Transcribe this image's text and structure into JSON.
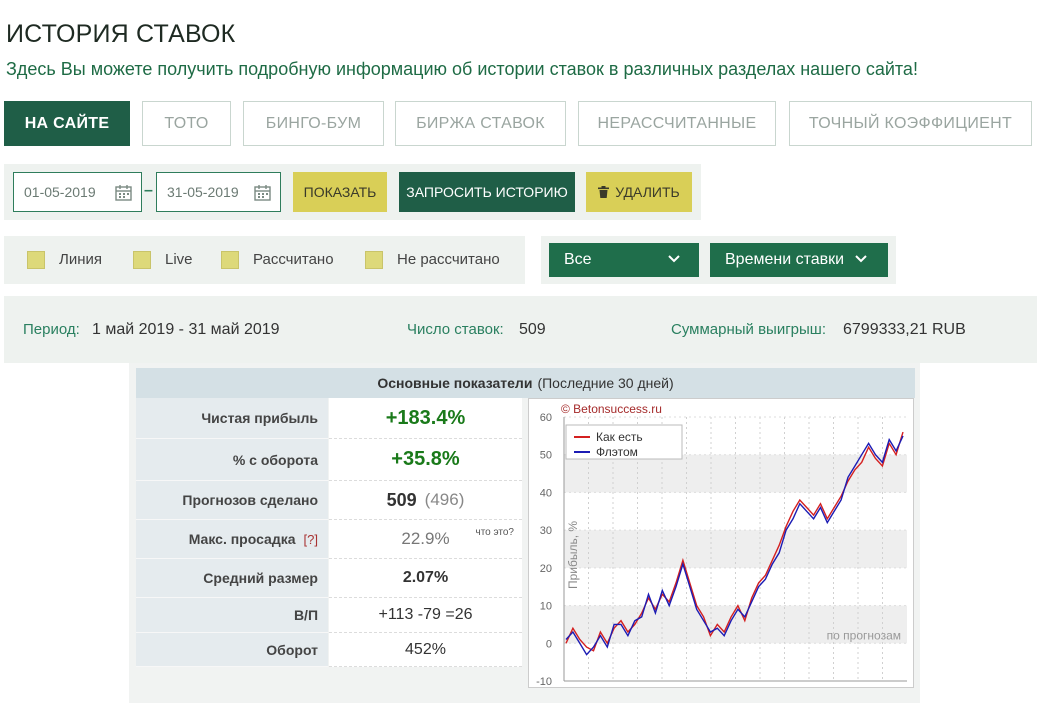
{
  "page": {
    "title": "ИСТОРИЯ СТАВОК",
    "subtitle": "Здесь Вы можете получить подробную информацию об истории ставок в различных разделах нашего сайта!"
  },
  "tabs": [
    {
      "label": "НА САЙТЕ",
      "active": true
    },
    {
      "label": "ТОТО",
      "active": false
    },
    {
      "label": "БИНГО-БУМ",
      "active": false
    },
    {
      "label": "БИРЖА СТАВОК",
      "active": false
    },
    {
      "label": "НЕРАССЧИТАННЫЕ",
      "active": false
    },
    {
      "label": "ТОЧНЫЙ КОЭФФИЦИЕНТ",
      "active": false
    }
  ],
  "toolbar": {
    "date_from": "01-05-2019",
    "date_to": "31-05-2019",
    "dash": "–",
    "show_label": "ПОКАЗАТЬ",
    "request_label": "ЗАПРОСИТЬ ИСТОРИЮ",
    "delete_label": "УДАЛИТЬ"
  },
  "filters": [
    "Линия",
    "Live",
    "Рассчитано",
    "Не рассчитано"
  ],
  "dropdowns": {
    "type": "Все",
    "sort": "Времени ставки"
  },
  "summary": {
    "period_label": "Период:",
    "period_value": "1 май 2019 - 31 май 2019",
    "count_label": "Число ставок:",
    "count_value": "509",
    "total_label": "Суммарный выигрыш:",
    "total_value": "6799333,21 RUB"
  },
  "stats": {
    "header_bold": "Основные показатели",
    "header_note": "(Последние 30 дней)",
    "rows": [
      {
        "label": "Чистая прибыль",
        "value": "+183.4%"
      },
      {
        "label": "% с оборота",
        "value": "+35.8%"
      },
      {
        "label": "Прогнозов сделано",
        "value": "509",
        "extra": "(496)"
      },
      {
        "label": "Макс. просадка",
        "q": "[?]",
        "value": "22.9%",
        "note": "что это?"
      },
      {
        "label": "Средний размер",
        "value": "2.07%"
      },
      {
        "label": "В/П",
        "value": "+113 -79 =26"
      },
      {
        "label": "Оборот",
        "value": "452%"
      }
    ]
  },
  "colors": {
    "brand_green": "#1f5e47",
    "accent_yellow": "#d9cf57",
    "positive": "#1a7a1a",
    "series_red": "#d42020",
    "series_blue": "#1c1cb4"
  },
  "chart_data": {
    "type": "line",
    "title": "© Betonsuccess.ru",
    "ylabel": "Прибыль, %",
    "xlabel": "",
    "note": "по прогнозам",
    "ylim": [
      -10,
      60
    ],
    "yticks": [
      -10,
      0,
      10,
      20,
      30,
      40,
      50,
      60
    ],
    "grid": true,
    "legend": "top-left",
    "series": [
      {
        "name": "Как есть",
        "color": "#d42020",
        "values": [
          0,
          4,
          1,
          -1,
          -2,
          3,
          0,
          4,
          6,
          3,
          5,
          8,
          12,
          9,
          13,
          11,
          16,
          22,
          16,
          10,
          7,
          2,
          5,
          3,
          7,
          10,
          6,
          12,
          16,
          18,
          22,
          26,
          31,
          35,
          38,
          36,
          34,
          37,
          33,
          36,
          39,
          43,
          46,
          48,
          52,
          49,
          47,
          53,
          50,
          56
        ]
      },
      {
        "name": "Флэтом",
        "color": "#1c1cb4",
        "values": [
          1,
          3,
          0,
          -3,
          -1,
          2,
          -1,
          5,
          5,
          2,
          6,
          7,
          13,
          8,
          14,
          10,
          15,
          21,
          15,
          9,
          6,
          3,
          4,
          2,
          6,
          9,
          7,
          11,
          15,
          17,
          21,
          24,
          30,
          33,
          37,
          35,
          33,
          36,
          32,
          35,
          38,
          44,
          47,
          50,
          53,
          50,
          48,
          54,
          51,
          55
        ]
      }
    ]
  }
}
